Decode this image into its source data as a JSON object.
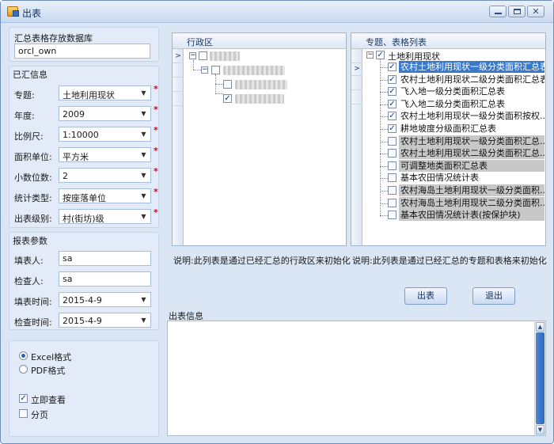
{
  "window": {
    "title": "出表"
  },
  "db_section": {
    "label": "汇总表格存放数据库",
    "value": "orcl_own"
  },
  "summary_info": {
    "title": "已汇信息",
    "fields": {
      "topic": {
        "label": "专题:",
        "value": "土地利用现状"
      },
      "year": {
        "label": "年度:",
        "value": "2009"
      },
      "scale": {
        "label": "比例尺:",
        "value": "1:10000"
      },
      "area_unit": {
        "label": "面积单位:",
        "value": "平方米"
      },
      "decimals": {
        "label": "小数位数:",
        "value": "2"
      },
      "stat_type": {
        "label": "统计类型:",
        "value": "按座落单位"
      },
      "output_level": {
        "label": "出表级别:",
        "value": "村(街坊)级"
      }
    },
    "required_mark": "*"
  },
  "report_params": {
    "title": "报表参数",
    "filler": {
      "label": "填表人:",
      "value": "sa"
    },
    "checker": {
      "label": "检查人:",
      "value": "sa"
    },
    "fill_time": {
      "label": "填表时间:",
      "value": "2015-4-9"
    },
    "check_time": {
      "label": "检查时间:",
      "value": "2015-4-9"
    }
  },
  "format_options": {
    "excel": "Excel格式",
    "pdf": "PDF格式",
    "selected": "excel"
  },
  "view_options": {
    "view_now": {
      "label": "立即查看",
      "checked": true
    },
    "paginate": {
      "label": "分页",
      "checked": false
    }
  },
  "region_grid": {
    "header": "行政区",
    "row_indicator": ">",
    "description": "说明:此列表是通过已经汇总的行政区来初始化"
  },
  "topic_grid": {
    "header": "专题、表格列表",
    "row_indicator": ">",
    "root": {
      "label": "土地利用现状",
      "checked": true
    },
    "items": [
      {
        "label": "农村土地利用现状一级分类面积汇总表",
        "checked": true,
        "state": "selected"
      },
      {
        "label": "农村土地利用现状二级分类面积汇总表",
        "checked": true,
        "state": "normal"
      },
      {
        "label": "飞入地一级分类面积汇总表",
        "checked": true,
        "state": "normal"
      },
      {
        "label": "飞入地二级分类面积汇总表",
        "checked": true,
        "state": "normal"
      },
      {
        "label": "农村土地利用现状一级分类面积按权...",
        "checked": true,
        "state": "normal"
      },
      {
        "label": "耕地坡度分级面积汇总表",
        "checked": true,
        "state": "normal"
      },
      {
        "label": "农村土地利用现状一级分类面积汇总...",
        "checked": false,
        "state": "highlight"
      },
      {
        "label": "农村土地利用现状二级分类面积汇总...",
        "checked": false,
        "state": "highlight"
      },
      {
        "label": "可调整地类面积汇总表",
        "checked": false,
        "state": "highlight"
      },
      {
        "label": "基本农田情况统计表",
        "checked": false,
        "state": "normal"
      },
      {
        "label": "农村海岛土地利用现状一级分类面积...",
        "checked": false,
        "state": "highlight"
      },
      {
        "label": "农村海岛土地利用现状二级分类面积...",
        "checked": false,
        "state": "highlight"
      },
      {
        "label": "基本农田情况统计表(按保护块)",
        "checked": false,
        "state": "highlight"
      }
    ],
    "description": "说明:此列表是通过已经汇总的专题和表格来初始化"
  },
  "actions": {
    "export": "出表",
    "exit": "退出"
  },
  "output_info": {
    "title": "出表信息"
  },
  "colors": {
    "selected_row": "#3a79c9",
    "highlight_row": "#c8c8c8",
    "required": "#e0001b",
    "window_bg": "#dbe6f4"
  }
}
